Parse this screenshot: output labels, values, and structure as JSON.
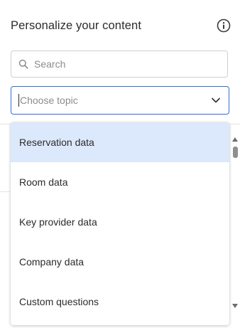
{
  "header": {
    "title": "Personalize your content",
    "info_icon": "info-circle-icon"
  },
  "search": {
    "placeholder": "Search",
    "value": "",
    "icon": "search-icon"
  },
  "topic_select": {
    "placeholder": "Choose topic",
    "chevron_icon": "chevron-down-icon",
    "accent_color": "#2f6fdc",
    "options": [
      {
        "label": "Reservation data",
        "highlighted": true
      },
      {
        "label": "Room data",
        "highlighted": false
      },
      {
        "label": "Key provider data",
        "highlighted": false
      },
      {
        "label": "Company data",
        "highlighted": false
      },
      {
        "label": "Custom questions",
        "highlighted": false
      }
    ],
    "highlight_color": "#dce8fb"
  }
}
